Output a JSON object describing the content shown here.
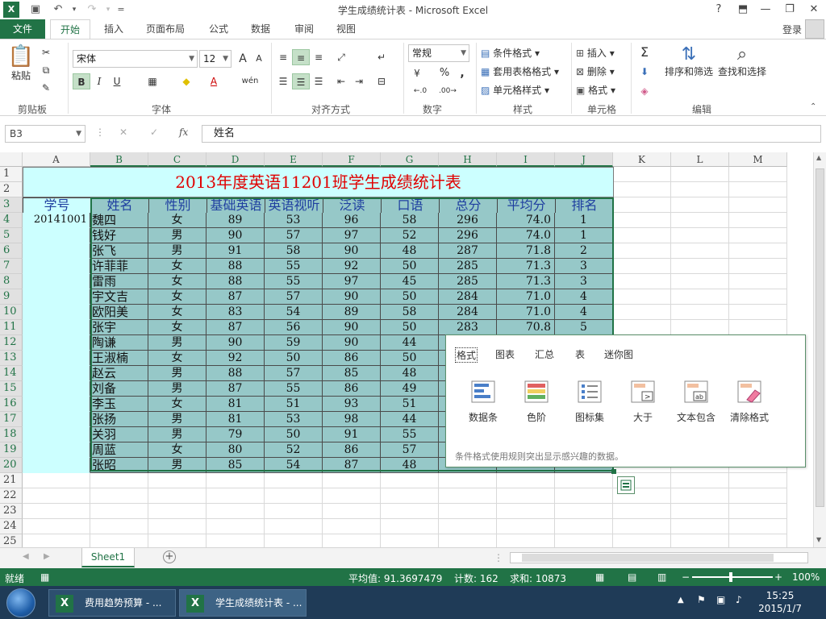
{
  "window": {
    "title": "学生成绩统计表 - Microsoft Excel",
    "help": "?",
    "qat_more": "="
  },
  "ribbon": {
    "tabs": [
      "文件",
      "开始",
      "插入",
      "页面布局",
      "公式",
      "数据",
      "审阅",
      "视图"
    ],
    "active_tab": "开始",
    "login": "登录",
    "clipboard": {
      "paste": "粘贴",
      "label": "剪贴板"
    },
    "font": {
      "name": "宋体",
      "size": "12",
      "label": "字体",
      "bold": "B",
      "italic": "I",
      "underline": "U",
      "grow": "A",
      "shrink": "A",
      "color": "A",
      "phonetic": "wén"
    },
    "alignment": {
      "label": "对齐方式"
    },
    "number": {
      "format": "常规",
      "percent": "%",
      "comma": ",",
      "label": "数字",
      "inc_decimal": "←.0",
      "dec_decimal": ".00→"
    },
    "styles": {
      "conditional": "条件格式",
      "table": "套用表格格式",
      "cell": "单元格样式",
      "label": "样式"
    },
    "cells": {
      "insert": "插入",
      "delete": "删除",
      "format": "格式",
      "label": "单元格"
    },
    "editing": {
      "sort": "排序和筛选",
      "find": "查找和选择",
      "label": "编辑",
      "sum": "Σ"
    }
  },
  "formula_bar": {
    "namebox": "B3",
    "fx": "fx",
    "cancel": "✕",
    "enter": "✓",
    "value": "姓名"
  },
  "sheet": {
    "columns": [
      "A",
      "B",
      "C",
      "D",
      "E",
      "F",
      "G",
      "H",
      "I",
      "J",
      "K",
      "L",
      "M"
    ],
    "rows": [
      "1",
      "2",
      "3",
      "4",
      "5",
      "6",
      "7",
      "8",
      "9",
      "10",
      "11",
      "12",
      "13",
      "14",
      "15",
      "16",
      "17",
      "18",
      "19",
      "20",
      "21",
      "22",
      "23",
      "24",
      "25"
    ],
    "title": "2013年度英语11201班学生成绩统计表",
    "headers": [
      "学号",
      "姓名",
      "性别",
      "基础英语",
      "英语视听",
      "泛读",
      "口语",
      "总分",
      "平均分",
      "排名"
    ],
    "first_id": "20141001",
    "students": [
      [
        "魏四",
        "女",
        "89",
        "53",
        "96",
        "58",
        "296",
        "74.0",
        "1"
      ],
      [
        "钱好",
        "男",
        "90",
        "57",
        "97",
        "52",
        "296",
        "74.0",
        "1"
      ],
      [
        "张飞",
        "男",
        "91",
        "58",
        "90",
        "48",
        "287",
        "71.8",
        "2"
      ],
      [
        "许菲菲",
        "女",
        "88",
        "55",
        "92",
        "50",
        "285",
        "71.3",
        "3"
      ],
      [
        "雷雨",
        "女",
        "88",
        "55",
        "97",
        "45",
        "285",
        "71.3",
        "3"
      ],
      [
        "宇文吉",
        "女",
        "87",
        "57",
        "90",
        "50",
        "284",
        "71.0",
        "4"
      ],
      [
        "欧阳美",
        "女",
        "83",
        "54",
        "89",
        "58",
        "284",
        "71.0",
        "4"
      ],
      [
        "张宇",
        "女",
        "87",
        "56",
        "90",
        "50",
        "283",
        "70.8",
        "5"
      ],
      [
        "陶谦",
        "男",
        "90",
        "59",
        "90",
        "44",
        "",
        "",
        ""
      ],
      [
        "王淑楠",
        "女",
        "92",
        "50",
        "86",
        "50",
        "",
        "",
        ""
      ],
      [
        "赵云",
        "男",
        "88",
        "57",
        "85",
        "48",
        "",
        "",
        ""
      ],
      [
        "刘备",
        "男",
        "87",
        "55",
        "86",
        "49",
        "",
        "",
        ""
      ],
      [
        "李玉",
        "女",
        "81",
        "51",
        "93",
        "51",
        "",
        "",
        ""
      ],
      [
        "张扬",
        "男",
        "81",
        "53",
        "98",
        "44",
        "",
        "",
        ""
      ],
      [
        "关羽",
        "男",
        "79",
        "50",
        "91",
        "55",
        "",
        "",
        ""
      ],
      [
        "周蓝",
        "女",
        "80",
        "52",
        "86",
        "57",
        "",
        "",
        ""
      ],
      [
        "张昭",
        "男",
        "85",
        "54",
        "87",
        "48",
        "",
        "",
        ""
      ]
    ]
  },
  "quick_analysis": {
    "tabs": [
      "格式",
      "图表",
      "汇总",
      "表",
      "迷你图"
    ],
    "active": "格式",
    "items": [
      "数据条",
      "色阶",
      "图标集",
      "大于",
      "文本包含",
      "清除格式"
    ],
    "description": "条件格式使用规则突出显示感兴趣的数据。"
  },
  "sheet_tabs": {
    "active": "Sheet1",
    "add": "+"
  },
  "status": {
    "ready": "就绪",
    "average": "平均值: 91.3697479",
    "count": "计数: 162",
    "sum": "求和: 10873",
    "zoom": "100%"
  },
  "taskbar": {
    "items": [
      "费用趋势预算 - ...",
      "学生成绩统计表 - ..."
    ],
    "time": "15:25",
    "date": "2015/1/7"
  },
  "colors": {
    "excel_green": "#217346",
    "title_red": "#e00000",
    "header_blue": "#1f3fa0",
    "light_cyan": "#ccffff",
    "data_teal": "#96c8c8"
  }
}
